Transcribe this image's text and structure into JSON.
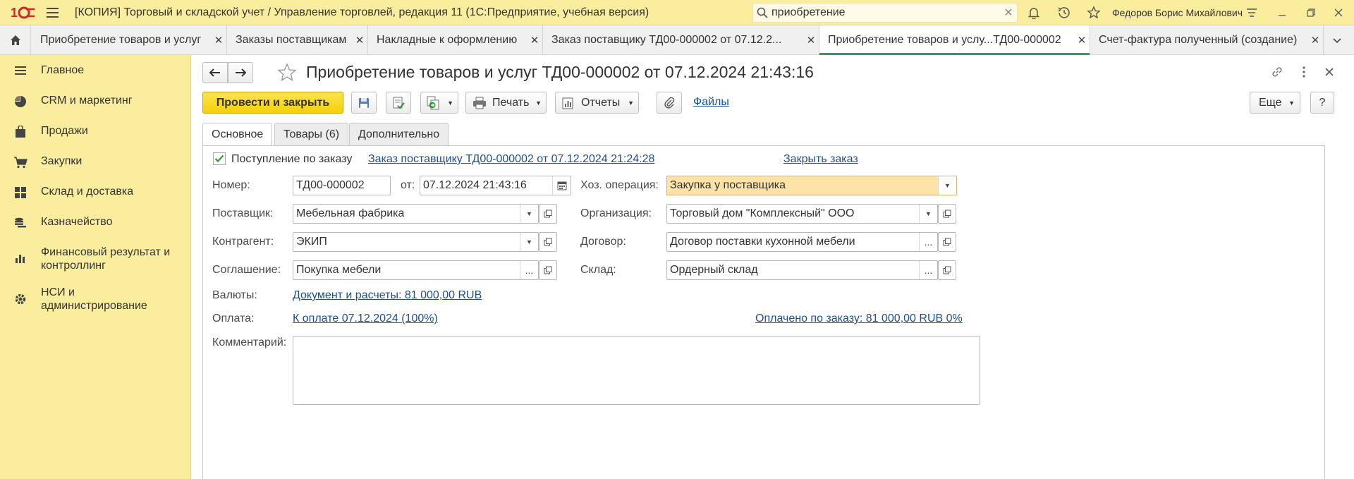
{
  "app": {
    "title": "[КОПИЯ] Торговый и складской учет / Управление торговлей, редакция 11  (1С:Предприятие, учебная версия)",
    "search_value": "приобретение",
    "user": "Федоров Борис Михайлович"
  },
  "open_tabs": [
    {
      "label": "Приобретение товаров и услуг"
    },
    {
      "label": "Заказы поставщикам"
    },
    {
      "label": "Накладные к оформлению"
    },
    {
      "label": "Заказ поставщику ТД00-000002 от 07.12.2..."
    },
    {
      "label": "Приобретение товаров и услу...ТД00-000002"
    },
    {
      "label": "Счет-фактура полученный (создание)"
    }
  ],
  "sidebar": {
    "items": [
      {
        "label": "Главное",
        "icon": "list-icon"
      },
      {
        "label": "CRM и маркетинг",
        "icon": "pie-chart-icon"
      },
      {
        "label": "Продажи",
        "icon": "shopping-bag-icon"
      },
      {
        "label": "Закупки",
        "icon": "cart-icon"
      },
      {
        "label": "Склад и доставка",
        "icon": "warehouse-icon"
      },
      {
        "label": "Казначейство",
        "icon": "coins-icon"
      },
      {
        "label": "Финансовый результат и\nконтроллинг",
        "icon": "bar-chart-icon"
      },
      {
        "label": "НСИ и\nадминистрирование",
        "icon": "gear-icon"
      }
    ]
  },
  "document": {
    "title": "Приобретение товаров и услуг ТД00-000002 от 07.12.2024 21:43:16"
  },
  "toolbar": {
    "post_close": "Провести и закрыть",
    "print": "Печать",
    "reports": "Отчеты",
    "files": "Файлы",
    "more": "Еще",
    "help": "?"
  },
  "form_tabs": [
    {
      "label": "Основное"
    },
    {
      "label": "Товары (6)"
    },
    {
      "label": "Дополнительно"
    }
  ],
  "form": {
    "by_order_label": "Поступление по заказу",
    "by_order_checked": true,
    "order_link": "Заказ поставщику ТД00-000002 от 07.12.2024 21:24:28",
    "close_order_link": "Закрыть заказ",
    "number_label": "Номер:",
    "number_value": "ТД00-000002",
    "from_label": "от:",
    "date_value": "07.12.2024 21:43:16",
    "operation_label": "Хоз. операция:",
    "operation_value": "Закупка у поставщика",
    "supplier_label": "Поставщик:",
    "supplier_value": "Мебельная фабрика",
    "organization_label": "Организация:",
    "organization_value": "Торговый дом \"Комплексный\" ООО",
    "counterparty_label": "Контрагент:",
    "counterparty_value": "ЭКИП",
    "contract_label": "Договор:",
    "contract_value": "Договор поставки кухонной мебели",
    "agreement_label": "Соглашение:",
    "agreement_value": "Покупка мебели",
    "warehouse_label": "Склад:",
    "warehouse_value": "Ордерный склад",
    "currency_label": "Валюты:",
    "currency_link": "Документ и расчеты: 81 000,00 RUB",
    "payment_label": "Оплата:",
    "payment_link": "К оплате 07.12.2024 (100%)",
    "paid_link": "Оплачено по заказу: 81 000,00 RUB 0%",
    "comment_label": "Комментарий:",
    "comment_value": ""
  },
  "colors": {
    "header_bg": "#fbed9e",
    "primary_button": "#f4cf0c",
    "link": "#1d4f8c",
    "active_tab_underline": "#3b9a5a",
    "highlight_field": "#fde3a8",
    "logo_red": "#d8232a"
  }
}
